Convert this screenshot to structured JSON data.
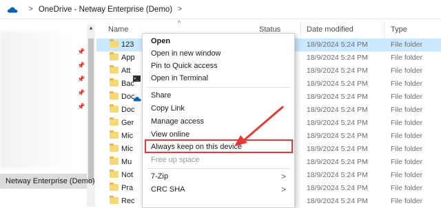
{
  "breadcrumb": {
    "items": [
      "OneDrive - Netway Enterprise (Demo)"
    ],
    "separator": ">"
  },
  "nav": {
    "selected_label": "Netway Enterprise (Demo)",
    "pins": [
      "pin-icon",
      "pin-icon",
      "pin-icon",
      "pin-icon",
      "pin-icon"
    ]
  },
  "columns": {
    "name": "Name",
    "status": "Status",
    "date_modified": "Date modified",
    "type": "Type"
  },
  "rows": [
    {
      "name": "123",
      "date": "18/9/2024 5:24 PM",
      "type": "File folder",
      "selected": true
    },
    {
      "name": "App",
      "date": "18/9/2024 5:24 PM",
      "type": "File folder"
    },
    {
      "name": "Att",
      "date": "18/9/2024 5:24 PM",
      "type": "File folder"
    },
    {
      "name": "Bac",
      "date": "18/9/2024 5:24 PM",
      "type": "File folder"
    },
    {
      "name": "Doc",
      "date": "18/9/2024 5:24 PM",
      "type": "File folder"
    },
    {
      "name": "Doc",
      "date": "18/9/2024 5:24 PM",
      "type": "File folder"
    },
    {
      "name": "Ger",
      "date": "18/9/2024 5:24 PM",
      "type": "File folder"
    },
    {
      "name": "Mic",
      "date": "18/9/2024 5:24 PM",
      "type": "File folder"
    },
    {
      "name": "Mic",
      "date": "18/9/2024 5:24 PM",
      "type": "File folder"
    },
    {
      "name": "Mu",
      "date": "18/9/2024 5:24 PM",
      "type": "File folder"
    },
    {
      "name": "Not",
      "date": "18/9/2024 5:24 PM",
      "type": "File folder"
    },
    {
      "name": "Pra",
      "date": "18/9/2024 5:24 PM",
      "type": "File folder"
    },
    {
      "name": "Rec",
      "date": "18/9/2024 5:24 PM",
      "type": "File folder"
    }
  ],
  "context_menu": {
    "open": "Open",
    "open_new_window": "Open in new window",
    "pin_quick_access": "Pin to Quick access",
    "open_terminal": "Open in Terminal",
    "share": "Share",
    "copy_link": "Copy Link",
    "manage_access": "Manage access",
    "view_online": "View online",
    "always_keep": "Always keep on this device",
    "free_up_space": "Free up space",
    "seven_zip": "7-Zip",
    "crc_sha": "CRC SHA"
  },
  "colors": {
    "highlight_box": "#e53935",
    "arrow": "#e53935",
    "selection": "#cce8ff",
    "folder": "#f8d775",
    "onedrive": "#0364b8"
  }
}
